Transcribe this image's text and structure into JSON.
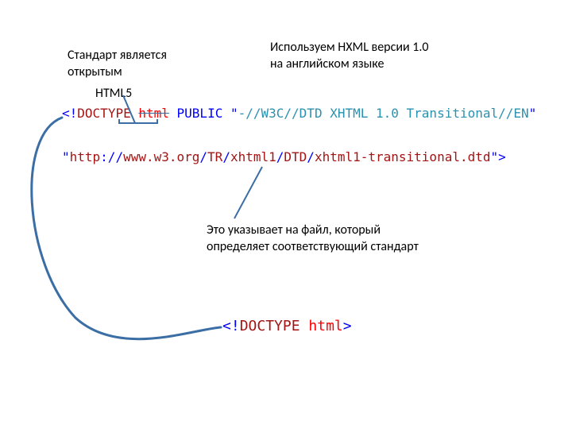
{
  "annotations": {
    "standard_open_1": "Стандарт является",
    "standard_open_2": "открытым",
    "html5_label": "HTML5",
    "hxml_1": "Используем HXML версии 1.0",
    "hxml_2": "на английском языке",
    "file_note_1": "Это указывает на файл, который",
    "file_note_2": "определяет соответствующий стандарт"
  },
  "code": {
    "line1": {
      "lt": "<",
      "bang": "!",
      "doctype": "DOCTYPE",
      "sp1": " ",
      "html": "html",
      "sp2": " ",
      "public": "PUBLIC",
      "sp3": " ",
      "q1": "\"",
      "fpi": "-//W3C//DTD XHTML 1.0 Transitional//EN",
      "q2": "\""
    },
    "line2": {
      "q1": "\"",
      "scheme": "http",
      "c1": "://",
      "host": "www.w3.org",
      "c2": "/",
      "p1": "TR",
      "c3": "/",
      "p2": "xhtml1",
      "c4": "/",
      "p3": "DTD",
      "c5": "/",
      "file": "xhtml1-transitional.dtd",
      "q2": "\"",
      "gt": ">"
    },
    "line3": {
      "lt": "<",
      "bang": "!",
      "doctype": "DOCTYPE",
      "sp": " ",
      "html": "html",
      "gt": ">"
    }
  }
}
